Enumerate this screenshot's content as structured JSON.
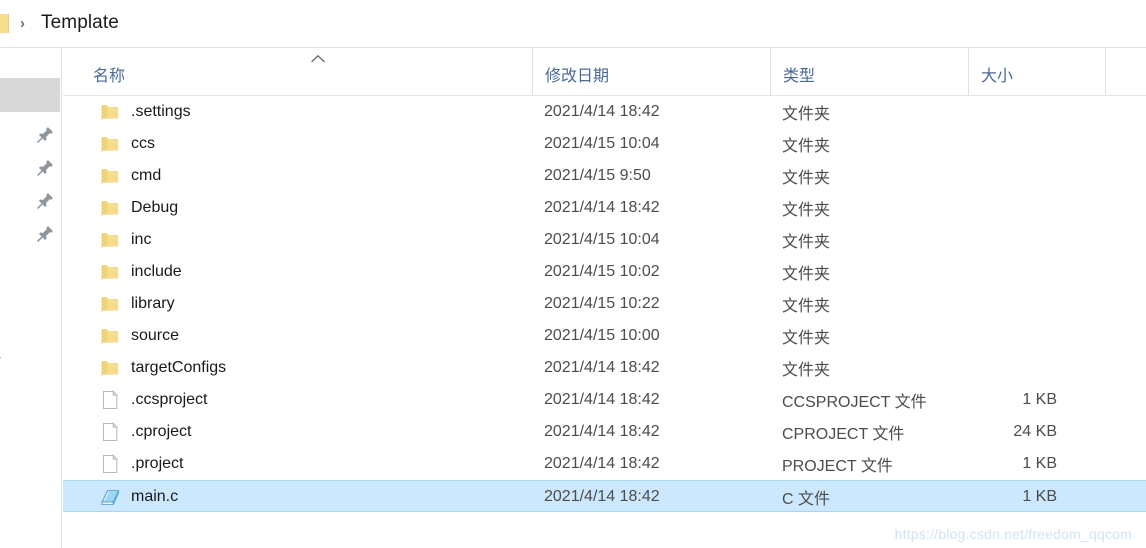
{
  "addressbar": {
    "breadcrumb_separator": "›",
    "path_label": "Template"
  },
  "navpane": {
    "truncated_label": "r",
    "pin_icon_name": "pin-icon",
    "pin_count": 4
  },
  "columns": [
    {
      "key": "name",
      "label": "名称",
      "sorted": "asc"
    },
    {
      "key": "date",
      "label": "修改日期",
      "sorted": ""
    },
    {
      "key": "type",
      "label": "类型",
      "sorted": ""
    },
    {
      "key": "size",
      "label": "大小",
      "sorted": ""
    }
  ],
  "rows": [
    {
      "name": ".settings",
      "date": "2021/4/14 18:42",
      "type": "文件夹",
      "size": "",
      "icon": "folder-icon",
      "selected": false
    },
    {
      "name": "ccs",
      "date": "2021/4/15 10:04",
      "type": "文件夹",
      "size": "",
      "icon": "folder-icon",
      "selected": false
    },
    {
      "name": "cmd",
      "date": "2021/4/15 9:50",
      "type": "文件夹",
      "size": "",
      "icon": "folder-icon",
      "selected": false
    },
    {
      "name": "Debug",
      "date": "2021/4/14 18:42",
      "type": "文件夹",
      "size": "",
      "icon": "folder-icon",
      "selected": false
    },
    {
      "name": "inc",
      "date": "2021/4/15 10:04",
      "type": "文件夹",
      "size": "",
      "icon": "folder-icon",
      "selected": false
    },
    {
      "name": "include",
      "date": "2021/4/15 10:02",
      "type": "文件夹",
      "size": "",
      "icon": "folder-icon",
      "selected": false
    },
    {
      "name": "library",
      "date": "2021/4/15 10:22",
      "type": "文件夹",
      "size": "",
      "icon": "folder-icon",
      "selected": false
    },
    {
      "name": "source",
      "date": "2021/4/15 10:00",
      "type": "文件夹",
      "size": "",
      "icon": "folder-icon",
      "selected": false
    },
    {
      "name": "targetConfigs",
      "date": "2021/4/14 18:42",
      "type": "文件夹",
      "size": "",
      "icon": "folder-icon",
      "selected": false
    },
    {
      "name": ".ccsproject",
      "date": "2021/4/14 18:42",
      "type": "CCSPROJECT 文件",
      "size": "1 KB",
      "icon": "file-icon",
      "selected": false
    },
    {
      "name": ".cproject",
      "date": "2021/4/14 18:42",
      "type": "CPROJECT 文件",
      "size": "24 KB",
      "icon": "file-icon",
      "selected": false
    },
    {
      "name": ".project",
      "date": "2021/4/14 18:42",
      "type": "PROJECT 文件",
      "size": "1 KB",
      "icon": "file-icon",
      "selected": false
    },
    {
      "name": "main.c",
      "date": "2021/4/14 18:42",
      "type": "C 文件",
      "size": "1 KB",
      "icon": "c-source-icon",
      "selected": true
    }
  ],
  "watermark": {
    "text": "https://blog.csdn.net/freedom_qqcom"
  },
  "colors": {
    "selection": "#cce8ff",
    "selection_border": "#a8d4f2",
    "header_text": "#4a6a96",
    "folder": "#f6dd8d",
    "watermark": "#cfe4f5"
  }
}
